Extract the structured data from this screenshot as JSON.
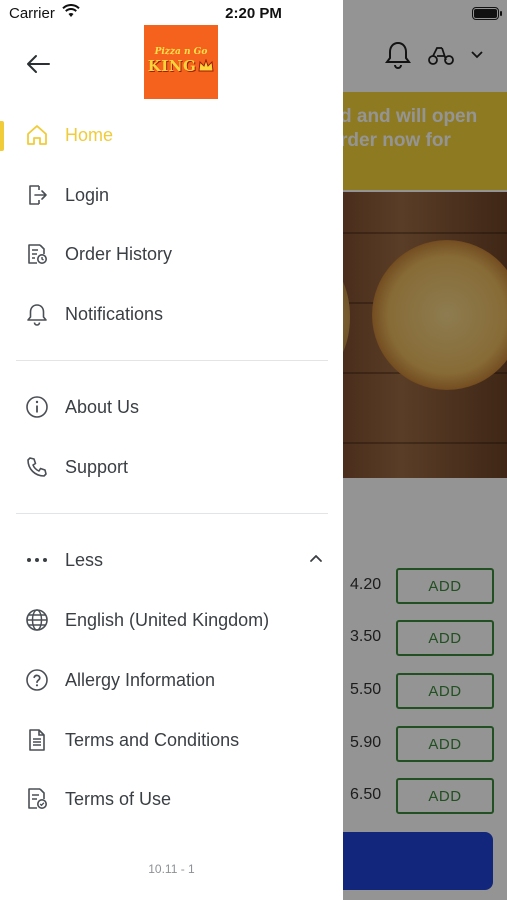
{
  "status_bar": {
    "carrier": "Carrier",
    "time": "2:20 PM"
  },
  "background": {
    "banner_line1": "d and will open",
    "banner_line2": "rder now for",
    "items": [
      {
        "price": "4.20",
        "add_label": "ADD"
      },
      {
        "price": "3.50",
        "add_label": "ADD"
      },
      {
        "price": "5.50",
        "add_label": "ADD"
      },
      {
        "price": "5.90",
        "add_label": "ADD"
      },
      {
        "price": "6.50",
        "add_label": "ADD"
      }
    ]
  },
  "drawer": {
    "logo_text_top": "Pizza n Go",
    "logo_text_main": "KING",
    "menu": [
      {
        "label": "Home",
        "icon": "home-icon",
        "active": true
      },
      {
        "label": "Login",
        "icon": "login-icon"
      },
      {
        "label": "Order History",
        "icon": "order-history-icon"
      },
      {
        "label": "Notifications",
        "icon": "bell-icon"
      }
    ],
    "info": [
      {
        "label": "About Us",
        "icon": "info-icon"
      },
      {
        "label": "Support",
        "icon": "phone-icon"
      }
    ],
    "more": [
      {
        "label": "Less",
        "icon": "more-dots-icon"
      },
      {
        "label": "English (United Kingdom)",
        "icon": "globe-icon"
      },
      {
        "label": "Allergy Information",
        "icon": "question-icon"
      },
      {
        "label": "Terms and Conditions",
        "icon": "document-icon"
      },
      {
        "label": "Terms of Use",
        "icon": "document-check-icon"
      }
    ],
    "version": "10.11 - 1"
  },
  "colors": {
    "accent": "#f0cc3a",
    "brand": "#f4621d",
    "add_green": "#3c8a3c",
    "cta_blue": "#1f44d6"
  }
}
